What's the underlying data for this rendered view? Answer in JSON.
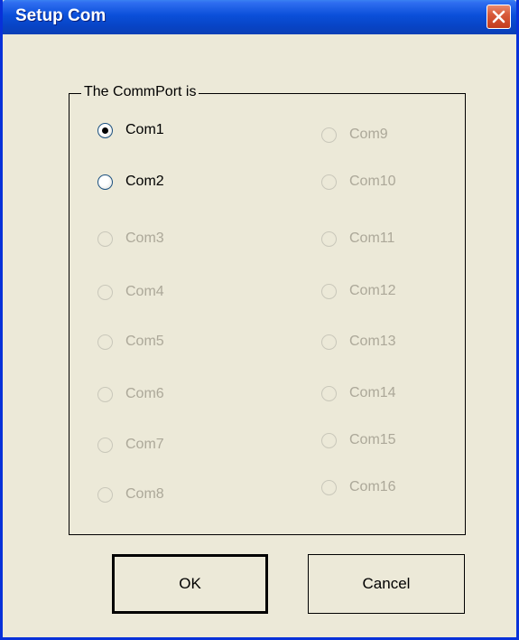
{
  "dialog": {
    "title": "Setup Com"
  },
  "group": {
    "label": "The CommPort is"
  },
  "ports": {
    "left": [
      {
        "label": "Com1",
        "enabled": true,
        "selected": true
      },
      {
        "label": "Com2",
        "enabled": true,
        "selected": false
      },
      {
        "label": "Com3",
        "enabled": false,
        "selected": false
      },
      {
        "label": "Com4",
        "enabled": false,
        "selected": false
      },
      {
        "label": "Com5",
        "enabled": false,
        "selected": false
      },
      {
        "label": "Com6",
        "enabled": false,
        "selected": false
      },
      {
        "label": "Com7",
        "enabled": false,
        "selected": false
      },
      {
        "label": "Com8",
        "enabled": false,
        "selected": false
      }
    ],
    "right": [
      {
        "label": "Com9",
        "enabled": false,
        "selected": false
      },
      {
        "label": "Com10",
        "enabled": false,
        "selected": false
      },
      {
        "label": "Com11",
        "enabled": false,
        "selected": false
      },
      {
        "label": "Com12",
        "enabled": false,
        "selected": false
      },
      {
        "label": "Com13",
        "enabled": false,
        "selected": false
      },
      {
        "label": "Com14",
        "enabled": false,
        "selected": false
      },
      {
        "label": "Com15",
        "enabled": false,
        "selected": false
      },
      {
        "label": "Com16",
        "enabled": false,
        "selected": false
      }
    ]
  },
  "buttons": {
    "ok_label": "OK",
    "cancel_label": "Cancel"
  },
  "colors": {
    "titlebar": "#0a4fd9",
    "dialog_bg": "#ece9d8",
    "disabled_text": "#aca899",
    "close_button": "#d85a3a"
  },
  "icons": {
    "close": "close-x-icon"
  }
}
